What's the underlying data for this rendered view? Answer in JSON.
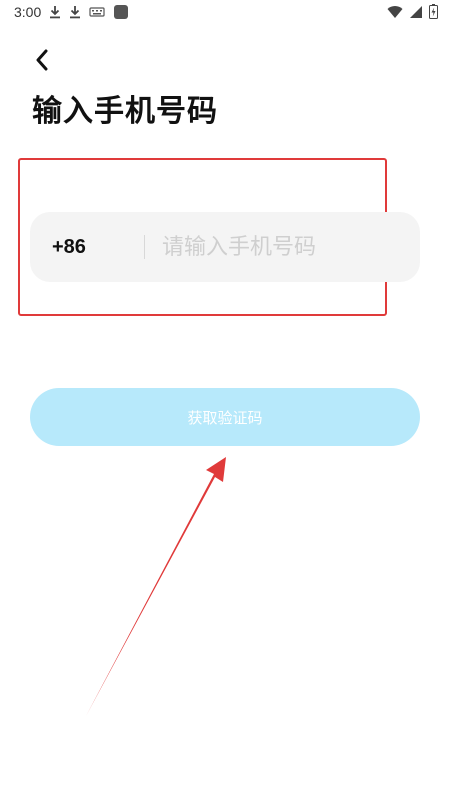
{
  "status_bar": {
    "time": "3:00",
    "icons_left": [
      "download-icon",
      "download-icon",
      "keyboard-icon",
      "app-icon"
    ],
    "icons_right": [
      "wifi-icon",
      "signal-icon",
      "battery-icon"
    ]
  },
  "header": {
    "title": "输入手机号码"
  },
  "phone": {
    "country_code": "+86",
    "value": "",
    "placeholder": "请输入手机号码"
  },
  "actions": {
    "get_code_label": "获取验证码"
  },
  "colors": {
    "annotation": "#e03a3a",
    "button_bg": "#b7e9fb",
    "input_bg": "#f4f4f4"
  }
}
